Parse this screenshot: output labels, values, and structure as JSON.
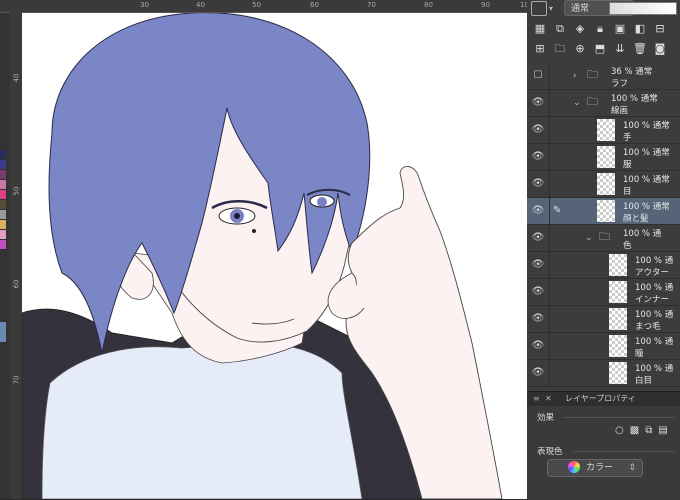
{
  "ruler": {
    "h_ticks": [
      "30",
      "40",
      "50",
      "60",
      "70",
      "80",
      "90",
      "100"
    ],
    "v_ticks": [
      "40",
      "50",
      "60",
      "70"
    ]
  },
  "colors": {
    "hair": "#7b86c6",
    "skin": "#fcf2f2",
    "jacket": "#34323d",
    "shirt": "#e6ebfa",
    "eye": "#7c80c8",
    "panel_bg": "#3c3c3c",
    "selected_layer": "#556577"
  },
  "toolbar": {
    "blend_mode": "通常"
  },
  "layers": [
    {
      "percent": "36 %",
      "mode": "通常",
      "name": "ラフ",
      "type": "folder",
      "expanded": false,
      "indent": 0,
      "selected": false
    },
    {
      "percent": "100 %",
      "mode": "通常",
      "name": "線画",
      "type": "folder",
      "expanded": true,
      "indent": 0,
      "selected": false
    },
    {
      "percent": "100 %",
      "mode": "通常",
      "name": "手",
      "type": "layer",
      "indent": 1,
      "selected": false
    },
    {
      "percent": "100 %",
      "mode": "通常",
      "name": "服",
      "type": "layer",
      "indent": 1,
      "selected": false
    },
    {
      "percent": "100 %",
      "mode": "通常",
      "name": "目",
      "type": "layer",
      "indent": 1,
      "selected": false
    },
    {
      "percent": "100 %",
      "mode": "通常",
      "name": "顔と髪",
      "type": "layer",
      "indent": 1,
      "selected": true
    },
    {
      "percent": "100 %",
      "mode": "通",
      "name": "色",
      "type": "folder",
      "expanded": true,
      "indent": 1,
      "selected": false
    },
    {
      "percent": "100 %",
      "mode": "通",
      "name": "アウター",
      "type": "layer",
      "indent": 2,
      "selected": false
    },
    {
      "percent": "100 %",
      "mode": "通",
      "name": "インナー",
      "type": "layer",
      "indent": 2,
      "selected": false
    },
    {
      "percent": "100 %",
      "mode": "通",
      "name": "まつ毛",
      "type": "layer",
      "indent": 2,
      "selected": false
    },
    {
      "percent": "100 %",
      "mode": "通",
      "name": "瞳",
      "type": "layer",
      "indent": 2,
      "selected": false
    },
    {
      "percent": "100 %",
      "mode": "通",
      "name": "白目",
      "type": "layer",
      "indent": 2,
      "selected": false
    }
  ],
  "properties": {
    "title": "レイヤープロパティ",
    "effect_label": "効果",
    "expression_label": "表現色",
    "expression_value": "カラー"
  }
}
